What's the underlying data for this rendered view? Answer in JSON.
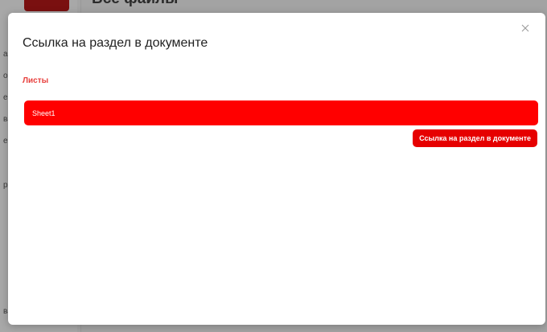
{
  "background": {
    "header_title": "Все файлы",
    "sidebar_fragments": [
      "ай",
      "ом",
      "е",
      "ва",
      "е",
      "р",
      "ва"
    ]
  },
  "modal": {
    "title": "Ссылка на раздел в документе",
    "close_glyph": "×",
    "section_label": "Листы",
    "sheets": [
      {
        "label": "Sheet1",
        "selected": true
      }
    ],
    "action_button_label": "Ссылка на раздел в документе"
  },
  "colors": {
    "accent": "#ff0000",
    "section_label": "#e8423f",
    "button": "#e60000"
  }
}
